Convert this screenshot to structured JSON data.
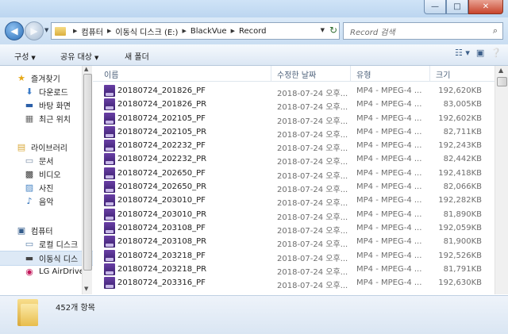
{
  "window": {
    "controls": {
      "minimize": "—",
      "maximize": "□",
      "close": "✕"
    }
  },
  "nav_buttons": {
    "back": "◀",
    "forward": "▶",
    "history": "▼"
  },
  "address": {
    "separator": "▶",
    "crumbs": [
      "컴퓨터",
      "이동식 디스크 (E:)",
      "BlackVue",
      "Record"
    ],
    "dropdown": "▼",
    "refresh": "↻"
  },
  "search": {
    "placeholder": "Record 검색",
    "icon": "search-icon"
  },
  "toolbar": {
    "organize": "구성",
    "share": "공유 대상",
    "new_folder": "새 폴더",
    "dropdown_arrow": "▼"
  },
  "sidebar": {
    "favorites": "즐겨찾기",
    "downloads": "다운로드",
    "desktop": "바탕 화면",
    "recent": "최근 위치",
    "libraries": "라이브러리",
    "documents": "문서",
    "videos": "비디오",
    "pictures": "사진",
    "music": "음악",
    "computer": "컴퓨터",
    "local_disk": "로컬 디스크",
    "removable_disk": "이동식 디스",
    "airdrive": "LG AirDrive"
  },
  "columns": {
    "name": "이름",
    "date": "수정한 날짜",
    "type": "유형",
    "size": "크기"
  },
  "files": [
    {
      "name": "20180724_201826_PF",
      "date": "2018-07-24 오후...",
      "type": "MP4 - MPEG-4 ...",
      "size": "192,620KB"
    },
    {
      "name": "20180724_201826_PR",
      "date": "2018-07-24 오후...",
      "type": "MP4 - MPEG-4 ...",
      "size": "83,005KB"
    },
    {
      "name": "20180724_202105_PF",
      "date": "2018-07-24 오후...",
      "type": "MP4 - MPEG-4 ...",
      "size": "192,602KB"
    },
    {
      "name": "20180724_202105_PR",
      "date": "2018-07-24 오후...",
      "type": "MP4 - MPEG-4 ...",
      "size": "82,711KB"
    },
    {
      "name": "20180724_202232_PF",
      "date": "2018-07-24 오후...",
      "type": "MP4 - MPEG-4 ...",
      "size": "192,243KB"
    },
    {
      "name": "20180724_202232_PR",
      "date": "2018-07-24 오후...",
      "type": "MP4 - MPEG-4 ...",
      "size": "82,442KB"
    },
    {
      "name": "20180724_202650_PF",
      "date": "2018-07-24 오후...",
      "type": "MP4 - MPEG-4 ...",
      "size": "192,418KB"
    },
    {
      "name": "20180724_202650_PR",
      "date": "2018-07-24 오후...",
      "type": "MP4 - MPEG-4 ...",
      "size": "82,066KB"
    },
    {
      "name": "20180724_203010_PF",
      "date": "2018-07-24 오후...",
      "type": "MP4 - MPEG-4 ...",
      "size": "192,282KB"
    },
    {
      "name": "20180724_203010_PR",
      "date": "2018-07-24 오후...",
      "type": "MP4 - MPEG-4 ...",
      "size": "81,890KB"
    },
    {
      "name": "20180724_203108_PF",
      "date": "2018-07-24 오후...",
      "type": "MP4 - MPEG-4 ...",
      "size": "192,059KB"
    },
    {
      "name": "20180724_203108_PR",
      "date": "2018-07-24 오후...",
      "type": "MP4 - MPEG-4 ...",
      "size": "81,900KB"
    },
    {
      "name": "20180724_203218_PF",
      "date": "2018-07-24 오후...",
      "type": "MP4 - MPEG-4 ...",
      "size": "192,526KB"
    },
    {
      "name": "20180724_203218_PR",
      "date": "2018-07-24 오후...",
      "type": "MP4 - MPEG-4 ...",
      "size": "81,791KB"
    },
    {
      "name": "20180724_203316_PF",
      "date": "2018-07-24 오후...",
      "type": "MP4 - MPEG-4 ...",
      "size": "192,630KB"
    }
  ],
  "status": {
    "item_count": "452개 항목"
  },
  "colors": {
    "accent": "#dde9f6",
    "file_icon": "#4b2a8a"
  }
}
